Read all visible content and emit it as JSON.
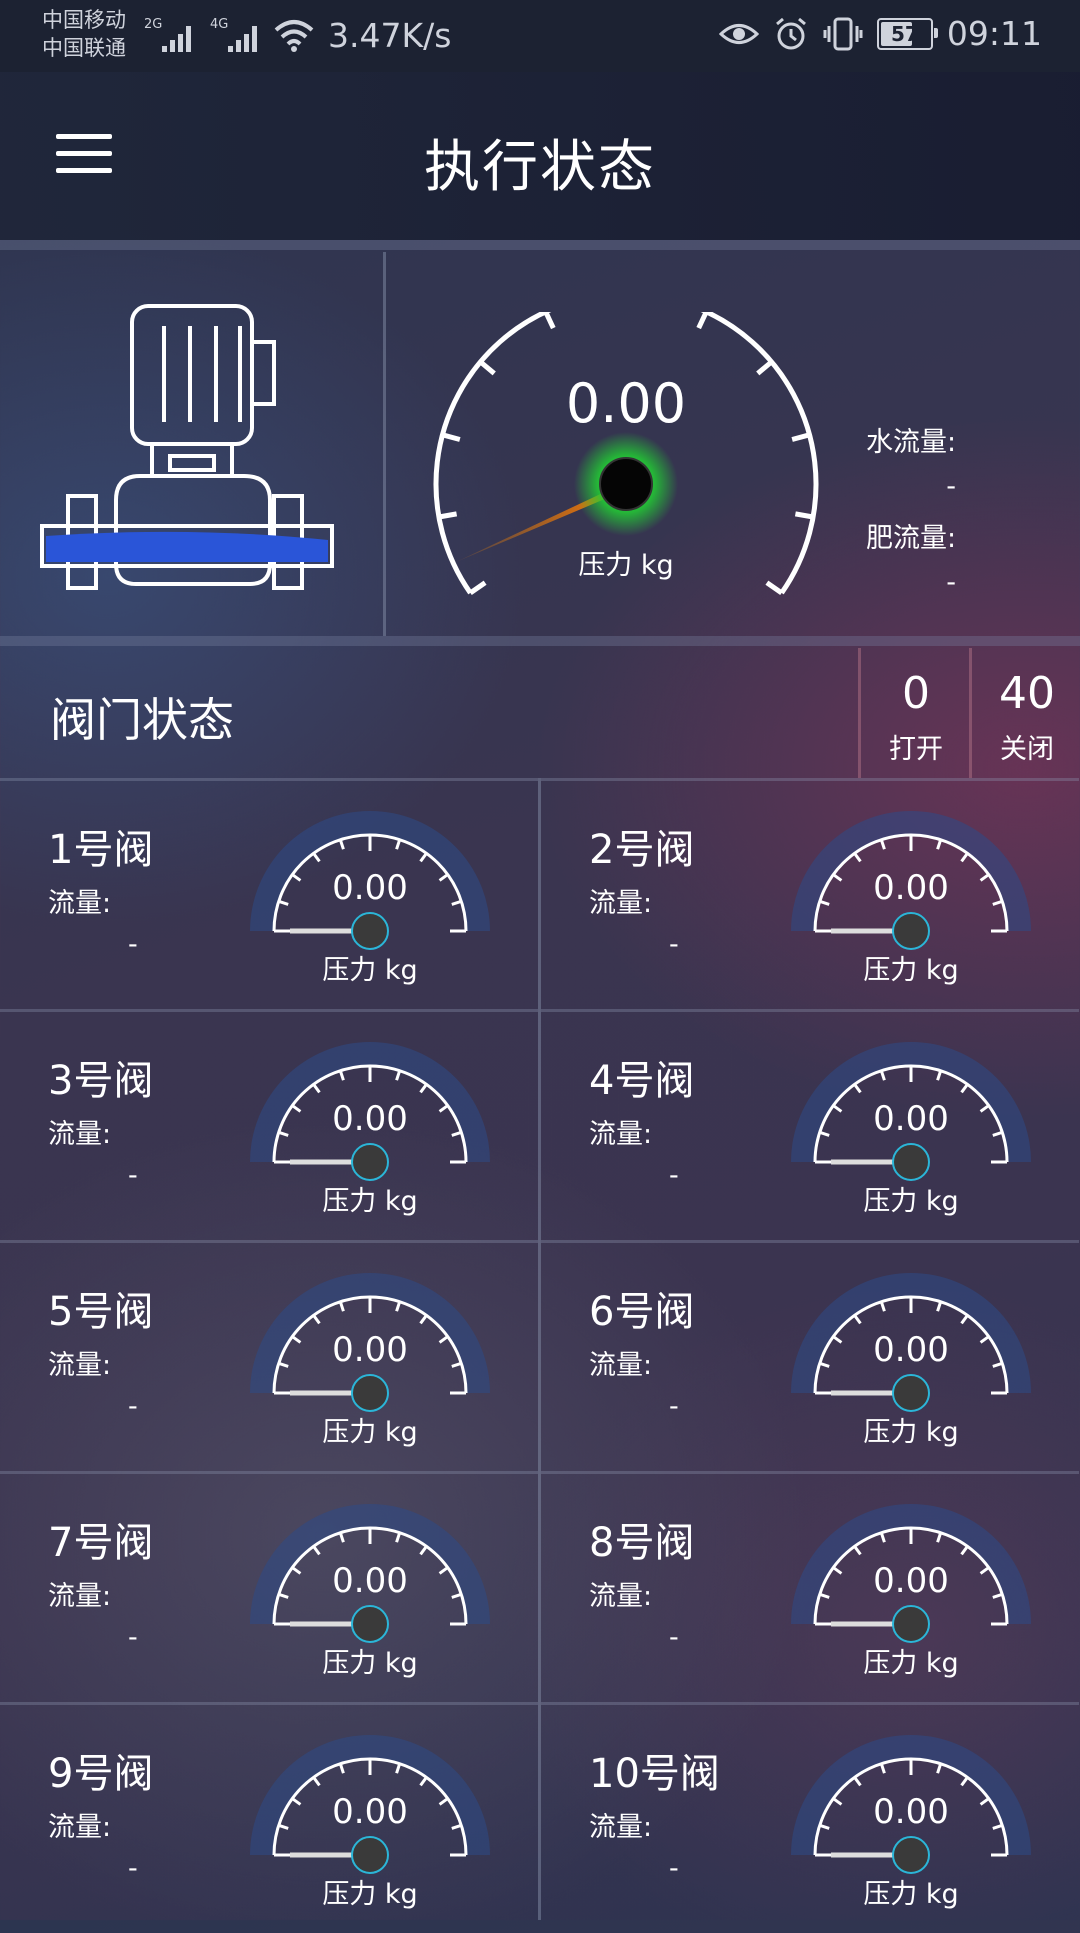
{
  "status_bar": {
    "carrier1": "中国移动",
    "carrier2": "中国联通",
    "sig1_label": "2G",
    "sig2_label": "4G",
    "net_speed": "3.47K/s",
    "battery": "57",
    "time": "09:11"
  },
  "header": {
    "title": "执行状态"
  },
  "main_gauge": {
    "value": "0.00",
    "unit_label": "压力 kg",
    "water_flow_label": "水流量:",
    "water_flow_value": "-",
    "fert_flow_label": "肥流量:",
    "fert_flow_value": "-"
  },
  "valve_status": {
    "title": "阀门状态",
    "open_count": "0",
    "open_label": "打开",
    "closed_count": "40",
    "closed_label": "关闭"
  },
  "valves": [
    {
      "name": "1号阀",
      "flow_label": "流量:",
      "flow_value": "-",
      "pressure": "0.00",
      "unit": "压力 kg"
    },
    {
      "name": "2号阀",
      "flow_label": "流量:",
      "flow_value": "-",
      "pressure": "0.00",
      "unit": "压力 kg"
    },
    {
      "name": "3号阀",
      "flow_label": "流量:",
      "flow_value": "-",
      "pressure": "0.00",
      "unit": "压力 kg"
    },
    {
      "name": "4号阀",
      "flow_label": "流量:",
      "flow_value": "-",
      "pressure": "0.00",
      "unit": "压力 kg"
    },
    {
      "name": "5号阀",
      "flow_label": "流量:",
      "flow_value": "-",
      "pressure": "0.00",
      "unit": "压力 kg"
    },
    {
      "name": "6号阀",
      "flow_label": "流量:",
      "flow_value": "-",
      "pressure": "0.00",
      "unit": "压力 kg"
    },
    {
      "name": "7号阀",
      "flow_label": "流量:",
      "flow_value": "-",
      "pressure": "0.00",
      "unit": "压力 kg"
    },
    {
      "name": "8号阀",
      "flow_label": "流量:",
      "flow_value": "-",
      "pressure": "0.00",
      "unit": "压力 kg"
    },
    {
      "name": "9号阀",
      "flow_label": "流量:",
      "flow_value": "-",
      "pressure": "0.00",
      "unit": "压力 kg"
    },
    {
      "name": "10号阀",
      "flow_label": "流量:",
      "flow_value": "-",
      "pressure": "0.00",
      "unit": "压力 kg"
    }
  ]
}
